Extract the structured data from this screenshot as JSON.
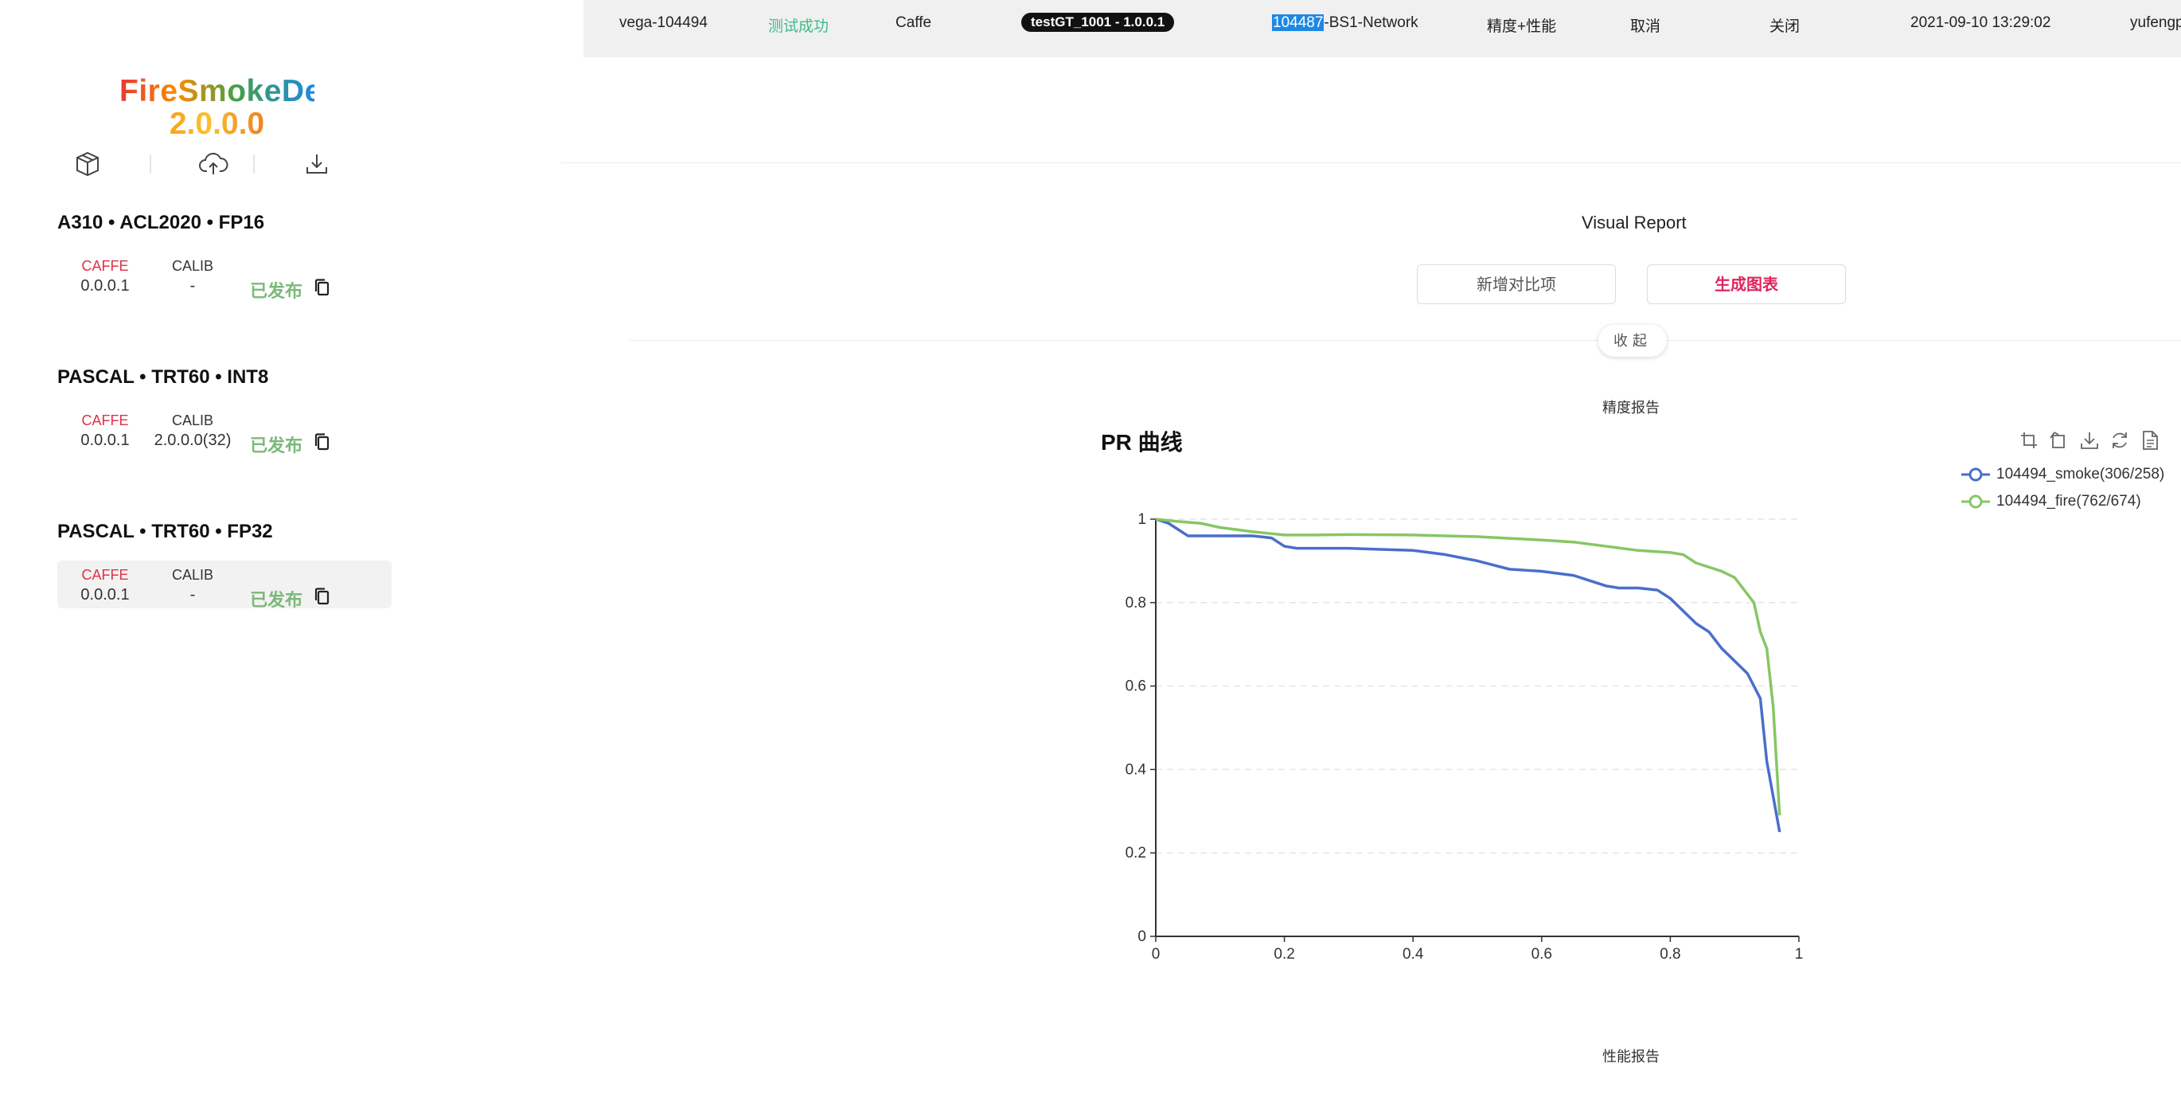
{
  "sidebar": {
    "logo_name": "FireSmokeDet",
    "logo_version": "2.0.0.0",
    "groups": [
      {
        "title": "A310 • ACL2020 • FP16",
        "framework_label": "CAFFE",
        "framework_version": "0.0.0.1",
        "calib_label": "CALIB",
        "calib_value": "-",
        "status": "已发布"
      },
      {
        "title": "PASCAL • TRT60 • INT8",
        "framework_label": "CAFFE",
        "framework_version": "0.0.0.1",
        "calib_label": "CALIB",
        "calib_value": "2.0.0.0(32)",
        "status": "已发布"
      },
      {
        "title": "PASCAL • TRT60 • FP32",
        "framework_label": "CAFFE",
        "framework_version": "0.0.0.1",
        "calib_label": "CALIB",
        "calib_value": "-",
        "status": "已发布"
      }
    ]
  },
  "topbar": {
    "name": "vega-104494",
    "status": "测试成功",
    "framework": "Caffe",
    "badge": "testGT_1001 - 1.0.0.1",
    "network_highlight": "104487",
    "network_rest": "-BS1-Network",
    "metric": "精度+性能",
    "cancel": "取消",
    "close": "关闭",
    "datetime": "2021-09-10 13:29:02",
    "user": "yufengp"
  },
  "main": {
    "report_title": "Visual Report",
    "add_compare_label": "新增对比项",
    "generate_chart_label": "生成图表",
    "collapse_label": "收起",
    "accuracy_section": "精度报告",
    "performance_section": "性能报告"
  },
  "chart_data": {
    "type": "line",
    "title": "PR 曲线",
    "xlabel": "",
    "ylabel": "",
    "xlim": [
      0,
      1
    ],
    "ylim": [
      0,
      1
    ],
    "xticks": [
      0,
      0.2,
      0.4,
      0.6,
      0.8,
      1
    ],
    "yticks": [
      0,
      0.2,
      0.4,
      0.6,
      0.8,
      1
    ],
    "grid": true,
    "legend_position": "top-right",
    "series": [
      {
        "name": "104494_smoke(306/258)",
        "color": "#4a6ecb",
        "x": [
          0,
          0.02,
          0.05,
          0.1,
          0.15,
          0.18,
          0.2,
          0.22,
          0.3,
          0.4,
          0.45,
          0.5,
          0.55,
          0.6,
          0.65,
          0.7,
          0.72,
          0.75,
          0.78,
          0.8,
          0.82,
          0.84,
          0.86,
          0.88,
          0.9,
          0.92,
          0.94,
          0.95,
          0.97
        ],
        "y": [
          1,
          0.99,
          0.96,
          0.96,
          0.96,
          0.955,
          0.935,
          0.93,
          0.93,
          0.925,
          0.915,
          0.9,
          0.88,
          0.875,
          0.865,
          0.84,
          0.835,
          0.835,
          0.83,
          0.81,
          0.78,
          0.75,
          0.73,
          0.69,
          0.66,
          0.63,
          0.57,
          0.42,
          0.25
        ]
      },
      {
        "name": "104494_fire(762/674)",
        "color": "#88c664",
        "x": [
          0,
          0.03,
          0.07,
          0.1,
          0.15,
          0.2,
          0.25,
          0.3,
          0.4,
          0.5,
          0.6,
          0.65,
          0.7,
          0.75,
          0.8,
          0.82,
          0.84,
          0.86,
          0.88,
          0.9,
          0.92,
          0.93,
          0.94,
          0.95,
          0.96,
          0.97
        ],
        "y": [
          1,
          0.995,
          0.99,
          0.98,
          0.97,
          0.962,
          0.962,
          0.963,
          0.962,
          0.958,
          0.95,
          0.945,
          0.935,
          0.925,
          0.92,
          0.915,
          0.895,
          0.885,
          0.875,
          0.86,
          0.82,
          0.8,
          0.73,
          0.69,
          0.55,
          0.29
        ]
      }
    ]
  }
}
